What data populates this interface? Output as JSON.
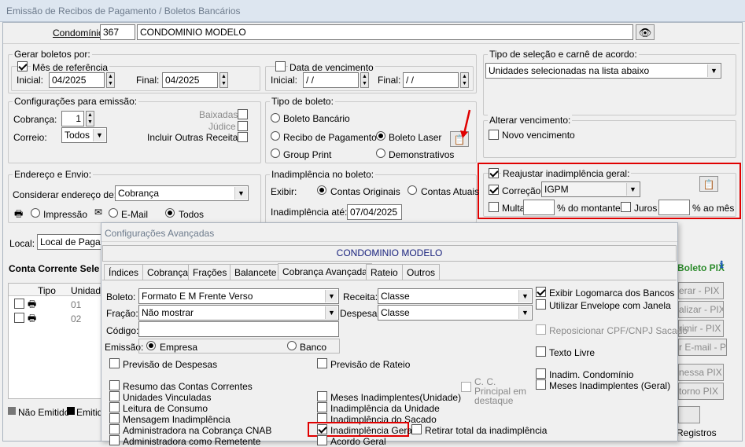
{
  "window": {
    "title": "Emissão de Recibos de Pagamento / Boletos Bancários"
  },
  "condominio": {
    "label": "Condomínio:",
    "code": "367",
    "name": "CONDOMINIO MODELO",
    "search_icon": "binoculars-icon"
  },
  "gerar": {
    "title": "Gerar boletos por:",
    "mes": {
      "label": "Mês de referência",
      "checked": true,
      "inicial_label": "Inicial:",
      "inicial": "04/2025",
      "final_label": "Final:",
      "final": "04/2025"
    },
    "venc": {
      "label": "Data de vencimento",
      "checked": false,
      "inicial_label": "Inicial:",
      "inicial": "/ /",
      "final_label": "Final:",
      "final": "/ /"
    }
  },
  "config": {
    "title": "Configurações para emissão:",
    "cobranca_label": "Cobrança:",
    "cobranca": "1",
    "correio_label": "Correio:",
    "correio": "Todos",
    "baixadas": "Baixadas",
    "judice": "Júdice",
    "incluir": "Incluir Outras Receitas"
  },
  "tipo": {
    "title": "Tipo de boleto:",
    "bancario": "Boleto Bancário",
    "recibo": "Recibo de Pagamento",
    "laser": "Boleto Laser",
    "group": "Group Print",
    "demo": "Demonstrativos",
    "selected": "Boleto Laser"
  },
  "selecao": {
    "title": "Tipo de seleção e carnê de acordo:",
    "value": "Unidades selecionadas na lista abaixo"
  },
  "alterar": {
    "title": "Alterar vencimento:",
    "novo": "Novo vencimento"
  },
  "reajuste": {
    "title": "Reajustar inadimplência geral:",
    "correcao": "Correção",
    "indice": "IGPM",
    "multa": "Multa",
    "multa_suffix": "% do montante",
    "juros": "Juros",
    "juros_suffix": "% ao mês"
  },
  "endereco": {
    "title": "Endereço e Envio:",
    "considerar": "Considerar endereço de:",
    "value": "Cobrança",
    "impressao": "Impressão",
    "email": "E-Mail",
    "todos": "Todos"
  },
  "inad": {
    "title": "Inadimplência no boleto:",
    "exibir": "Exibir:",
    "originais": "Contas Originais",
    "atuais": "Contas Atuais",
    "ate_label": "Inadimplência até:",
    "ate": "07/04/2025"
  },
  "local": {
    "label": "Local:",
    "value": "Local de Pagamen"
  },
  "conta": {
    "title": "Conta Corrente Sele",
    "col_tipo": "Tipo",
    "col_unid": "Unidade",
    "rows": [
      "01",
      "02"
    ],
    "legend_nao": "Não Emitido",
    "legend_emit": "Emitid"
  },
  "right": {
    "pix_title": "Boleto PIX",
    "b1": "erar - PIX",
    "b2": "alizar - PIX",
    "b3": "rimir - PIX",
    "b4": "r E-mail - PIX",
    "b5": "nessa PIX",
    "b6": "torno PIX",
    "registros": "Registros"
  },
  "dialog": {
    "title": "Configurações Avançadas",
    "header": "CONDOMINIO MODELO",
    "tabs": [
      "Índices",
      "Cobrança",
      "Frações",
      "Balancete",
      "Cobrança Avançada",
      "Rateio",
      "Outros"
    ],
    "active_tab": "Cobrança Avançada",
    "boleto_label": "Boleto:",
    "boleto": "Formato E M Frente Verso",
    "receita_label": "Receita:",
    "receita": "Classe",
    "fracao_label": "Fração:",
    "fracao": "Não mostrar",
    "despesa_label": "Despesa:",
    "despesa": "Classe",
    "codigo_label": "Código:",
    "codigo": "",
    "emissao_label": "Emissão:",
    "empresa": "Empresa",
    "banco": "Banco",
    "exibir_logo": "Exibir Logomarca dos Bancos",
    "envelope": "Utilizar Envelope com Janela",
    "reposicionar": "Reposicionar CPF/CNPJ Sacado",
    "texto_livre": "Texto Livre",
    "inadim_cond": "Inadim. Condomínio",
    "meses_geral": "Meses Inadimplentes (Geral)",
    "prev_desp": "Previsão de Despesas",
    "prev_rateio": "Previsão de Rateio",
    "cc_principal": "C. C. Principal em destaque",
    "left_list": [
      "Resumo das Contas Correntes",
      "Unidades Vinculadas",
      "Leitura de Consumo",
      "Mensagem Inadimplência",
      "Administradora na Cobrança CNAB",
      "Administradora como Remetente"
    ],
    "mid_list": [
      "Meses Inadimplentes(Unidade)",
      "Inadimplência da Unidade",
      "Inadimplência do Sacado",
      "Inadimplência Geral",
      "Acordo Geral"
    ],
    "retirar": "Retirar total da inadimplência"
  }
}
